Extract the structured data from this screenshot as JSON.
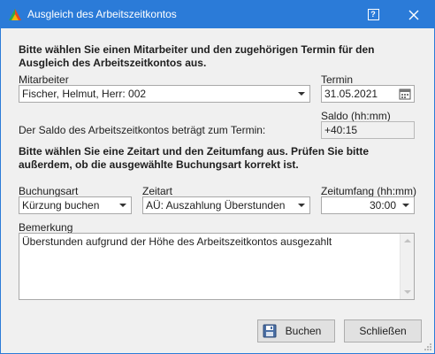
{
  "window": {
    "title": "Ausgleich des Arbeitszeitkontos",
    "help_glyph": "?",
    "app_icon": "triangle-logo-icon"
  },
  "intro": "Bitte wählen Sie einen Mitarbeiter und den zugehörigen Termin für den Ausgleich des Arbeitszeitkontos aus.",
  "employee": {
    "label": "Mitarbeiter",
    "value": "Fischer, Helmut, Herr: 002"
  },
  "date": {
    "label": "Termin",
    "value": "31.05.2021",
    "icon": "calendar-icon"
  },
  "balance": {
    "caption": "Der Saldo des Arbeitszeitkontos beträgt zum Termin:",
    "label": "Saldo (hh:mm)",
    "value": "+40:15"
  },
  "instructions": "Bitte wählen Sie eine Zeitart und den Zeitumfang aus. Prüfen Sie bitte außerdem, ob die ausgewählte Buchungsart korrekt ist.",
  "booking_type": {
    "label": "Buchungsart",
    "value": "Kürzung buchen"
  },
  "time_type": {
    "label": "Zeitart",
    "value": "AÜ: Auszahlung Überstunden"
  },
  "time_amount": {
    "label": "Zeitumfang (hh:mm)",
    "value": "30:00"
  },
  "remark": {
    "label": "Bemerkung",
    "value": "Überstunden aufgrund der Höhe des Arbeitszeitkontos ausgezahlt"
  },
  "buttons": {
    "book": "Buchen",
    "close": "Schließen"
  },
  "colors": {
    "titlebar": "#2b7bd8",
    "background": "#f0f0f0"
  }
}
